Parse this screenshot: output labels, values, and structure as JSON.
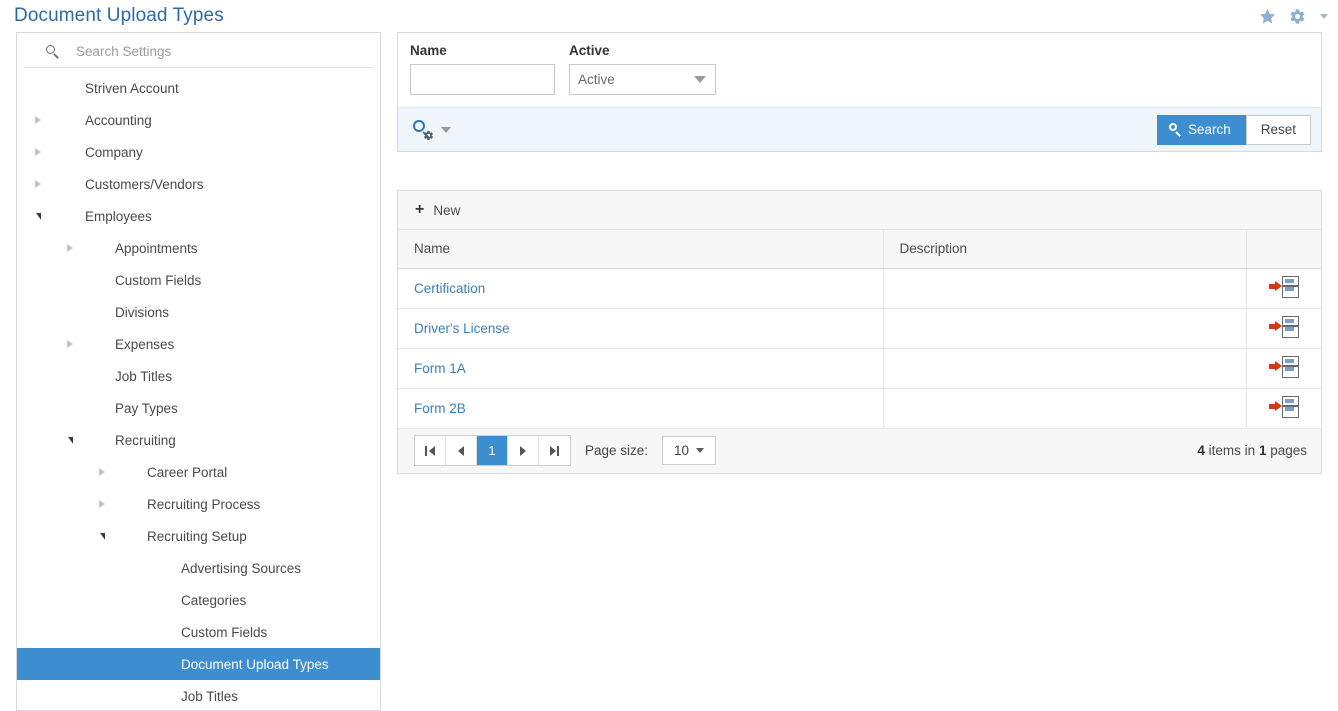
{
  "header": {
    "title": "Document Upload Types",
    "favorite_icon": "star-icon",
    "settings_icon": "gear-icon"
  },
  "sidebar": {
    "search": {
      "placeholder": "Search Settings",
      "icon": "search-icon"
    },
    "items": [
      {
        "label": "Striven Account",
        "indent": 0,
        "twisty": "none"
      },
      {
        "label": "Accounting",
        "indent": 0,
        "twisty": "collapsed"
      },
      {
        "label": "Company",
        "indent": 0,
        "twisty": "collapsed"
      },
      {
        "label": "Customers/Vendors",
        "indent": 0,
        "twisty": "collapsed"
      },
      {
        "label": "Employees",
        "indent": 0,
        "twisty": "expanded"
      },
      {
        "label": "Appointments",
        "indent": 1,
        "twisty": "collapsed"
      },
      {
        "label": "Custom Fields",
        "indent": 1,
        "twisty": "none"
      },
      {
        "label": "Divisions",
        "indent": 1,
        "twisty": "none"
      },
      {
        "label": "Expenses",
        "indent": 1,
        "twisty": "collapsed"
      },
      {
        "label": "Job Titles",
        "indent": 1,
        "twisty": "none"
      },
      {
        "label": "Pay Types",
        "indent": 1,
        "twisty": "none"
      },
      {
        "label": "Recruiting",
        "indent": 1,
        "twisty": "expanded"
      },
      {
        "label": "Career Portal",
        "indent": 2,
        "twisty": "collapsed"
      },
      {
        "label": "Recruiting Process",
        "indent": 2,
        "twisty": "collapsed"
      },
      {
        "label": "Recruiting Setup",
        "indent": 2,
        "twisty": "expanded"
      },
      {
        "label": "Advertising Sources",
        "indent": 3,
        "twisty": "none"
      },
      {
        "label": "Categories",
        "indent": 3,
        "twisty": "none"
      },
      {
        "label": "Custom Fields",
        "indent": 3,
        "twisty": "none"
      },
      {
        "label": "Document Upload Types",
        "indent": 3,
        "twisty": "none",
        "selected": true
      },
      {
        "label": "Job Titles",
        "indent": 3,
        "twisty": "none"
      }
    ]
  },
  "filter": {
    "name_label": "Name",
    "name_value": "",
    "active_label": "Active",
    "active_value": "Active",
    "search_settings_icon": "search-settings-icon",
    "search_button": "Search",
    "reset_button": "Reset"
  },
  "grid": {
    "new_button": "New",
    "columns": [
      "Name",
      "Description",
      ""
    ],
    "rows": [
      {
        "name": "Certification",
        "description": "",
        "action_icon": "insert-row-icon"
      },
      {
        "name": "Driver's License",
        "description": "",
        "action_icon": "insert-row-icon"
      },
      {
        "name": "Form 1A",
        "description": "",
        "action_icon": "insert-row-icon"
      },
      {
        "name": "Form 2B",
        "description": "",
        "action_icon": "insert-row-icon"
      }
    ]
  },
  "pager": {
    "first_icon": "first-page-icon",
    "prev_icon": "previous-page-icon",
    "current_page": "1",
    "next_icon": "next-page-icon",
    "last_icon": "last-page-icon",
    "page_size_label": "Page size:",
    "page_size_value": "10",
    "summary_count": "4",
    "summary_mid": " items in ",
    "summary_pages": "1",
    "summary_end": " pages"
  },
  "colors": {
    "accent": "#3d8ed0",
    "title": "#2f6aa8",
    "link": "#3d7fb5",
    "action_icon": "#cf3a13"
  }
}
